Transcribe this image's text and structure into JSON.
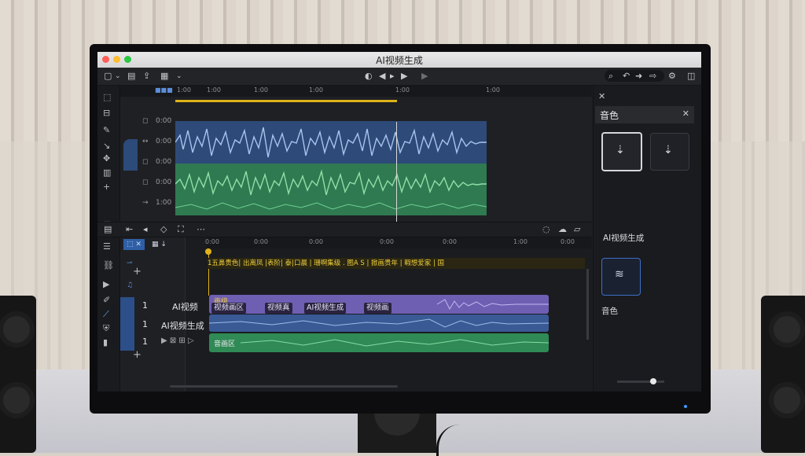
{
  "window": {
    "title": "AI视频生成"
  },
  "editor": {
    "ruler_labels": [
      "1:00",
      "1:00",
      "1:00",
      "1:00",
      "1:00",
      "1:00"
    ],
    "track_values": [
      "0:00",
      "0:00",
      "0:00",
      "0:00",
      "1:00"
    ]
  },
  "timeline": {
    "ruler_labels": [
      "0:00",
      "0:00",
      "0:00",
      "0:00",
      "0:00",
      "1:00",
      "0:00"
    ],
    "subtitle_text": "1五鼻贵色| 出离凤 |表阶| 泰|口晨 |  珊啊集级 .  图A  S  |  掀画贵年 |  暇想爱家 | 国",
    "tracks": [
      {
        "num": "1",
        "label": "AI视频"
      },
      {
        "num": "1",
        "label": "AI视频生成"
      },
      {
        "num": "1",
        "label": "▶ ⊠ ⊞ ▷"
      }
    ],
    "purple_clip_label": "画级",
    "chips": [
      "视频画区",
      "视频真",
      "AI视频生成",
      "视频画"
    ],
    "green_clip_label": "音画区"
  },
  "panel": {
    "title": "音色",
    "voice_label_1": "AI视频生成",
    "voice_label_2": "音色"
  },
  "colors": {
    "blue_wave": "#2d4a79",
    "green_wave": "#2f7a51",
    "playhead": "#e0b21a",
    "purple_clip": "#6f5fb3"
  }
}
